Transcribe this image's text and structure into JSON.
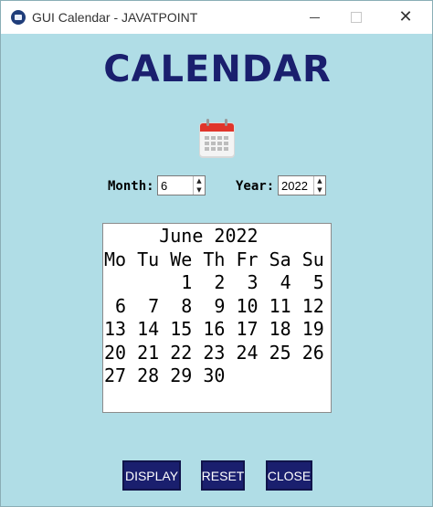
{
  "window": {
    "title": "GUI Calendar - JAVATPOINT",
    "icon": "calendar-app-icon",
    "controls": [
      "minimize",
      "maximize",
      "close"
    ],
    "close_glyph": "✕"
  },
  "heading": "CALENDAR",
  "image": {
    "icon": "calendar-icon"
  },
  "month": {
    "label": "Month:",
    "value": "6",
    "up": "▲",
    "down": "▼"
  },
  "year": {
    "label": "Year:",
    "value": "2022",
    "up": "▲",
    "down": "▼"
  },
  "calendar": {
    "title": "June 2022",
    "weekdays": [
      "Mo",
      "Tu",
      "We",
      "Th",
      "Fr",
      "Sa",
      "Su"
    ],
    "weeks": [
      [
        "",
        "",
        "1",
        "2",
        "3",
        "4",
        "5"
      ],
      [
        "6",
        "7",
        "8",
        "9",
        "10",
        "11",
        "12"
      ],
      [
        "13",
        "14",
        "15",
        "16",
        "17",
        "18",
        "19"
      ],
      [
        "20",
        "21",
        "22",
        "23",
        "24",
        "25",
        "26"
      ],
      [
        "27",
        "28",
        "29",
        "30",
        "",
        "",
        ""
      ]
    ]
  },
  "buttons": {
    "display": "DISPLAY",
    "reset": "RESET",
    "close": "CLOSE"
  },
  "colors": {
    "background": "#b0dde6",
    "heading": "#1a1f6e",
    "button_bg": "#1a1f6e",
    "button_text": "#ffffff"
  }
}
